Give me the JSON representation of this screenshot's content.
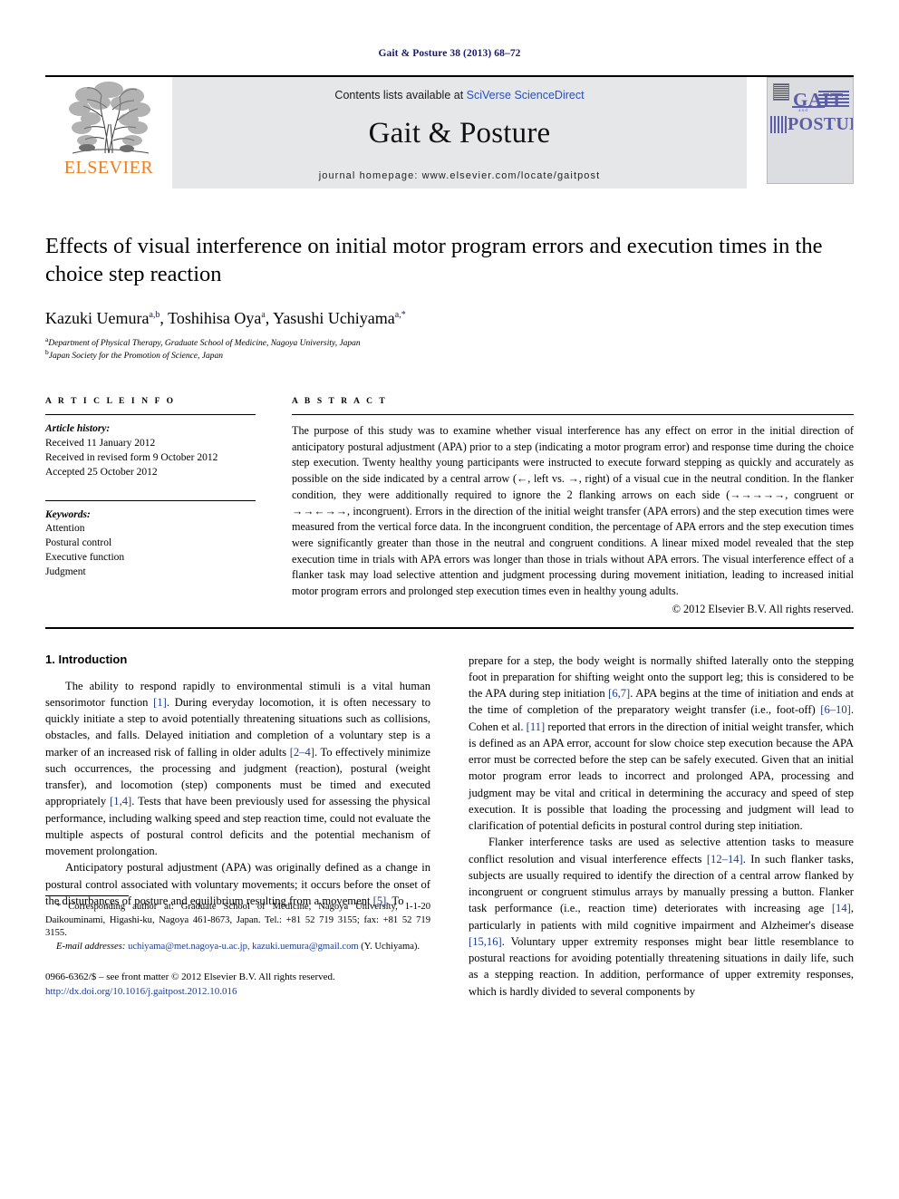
{
  "running_head": "Gait & Posture 38 (2013) 68–72",
  "masthead": {
    "contents_prefix": "Contents lists available at ",
    "sciencedirect": "SciVerse ScienceDirect",
    "journal_title": "Gait & Posture",
    "homepage": "journal homepage: www.elsevier.com/locate/gaitpost",
    "publisher_name": "ELSEVIER",
    "cover": {
      "line1": "GAIT",
      "line_mid": "and",
      "line2": "POSTURE"
    },
    "accent_link_color": "#2a4fb8",
    "elsevier_orange": "#ef7d22",
    "cover_purple": "#5b5ea6"
  },
  "article": {
    "title": "Effects of visual interference on initial motor program errors and execution times in the choice step reaction",
    "authors": "Kazuki Uemura a,b, Toshihisa Oya a, Yasushi Uchiyama a,*",
    "author_list": [
      {
        "name": "Kazuki Uemura",
        "sup": "a,b"
      },
      {
        "name": "Toshihisa Oya",
        "sup": "a"
      },
      {
        "name": "Yasushi Uchiyama",
        "sup": "a,*"
      }
    ],
    "affiliations": [
      {
        "marker": "a",
        "text": "Department of Physical Therapy, Graduate School of Medicine, Nagoya University, Japan"
      },
      {
        "marker": "b",
        "text": "Japan Society for the Promotion of Science, Japan"
      }
    ]
  },
  "article_info": {
    "label": "A R T I C L E    I N F O",
    "history_head": "Article history:",
    "history": [
      "Received 11 January 2012",
      "Received in revised form 9 October 2012",
      "Accepted 25 October 2012"
    ],
    "keywords_head": "Keywords:",
    "keywords": [
      "Attention",
      "Postural control",
      "Executive function",
      "Judgment"
    ]
  },
  "abstract": {
    "label": "A B S T R A C T",
    "text": "The purpose of this study was to examine whether visual interference has any effect on error in the initial direction of anticipatory postural adjustment (APA) prior to a step (indicating a motor program error) and response time during the choice step execution. Twenty healthy young participants were instructed to execute forward stepping as quickly and accurately as possible on the side indicated by a central arrow (←, left vs. →, right) of a visual cue in the neutral condition. In the flanker condition, they were additionally required to ignore the 2 flanking arrows on each side (→→→→→, congruent or →→←→→, incongruent). Errors in the direction of the initial weight transfer (APA errors) and the step execution times were measured from the vertical force data. In the incongruent condition, the percentage of APA errors and the step execution times were significantly greater than those in the neutral and congruent conditions. A linear mixed model revealed that the step execution time in trials with APA errors was longer than those in trials without APA errors. The visual interference effect of a flanker task may load selective attention and judgment processing during movement initiation, leading to increased initial motor program errors and prolonged step execution times even in healthy young adults.",
    "copyright": "© 2012 Elsevier B.V. All rights reserved."
  },
  "introduction": {
    "heading": "1. Introduction",
    "left_paragraphs": [
      "The ability to respond rapidly to environmental stimuli is a vital human sensorimotor function [1]. During everyday locomotion, it is often necessary to quickly initiate a step to avoid potentially threatening situations such as collisions, obstacles, and falls. Delayed initiation and completion of a voluntary step is a marker of an increased risk of falling in older adults [2–4]. To effectively minimize such occurrences, the processing and judgment (reaction), postural (weight transfer), and locomotion (step) components must be timed and executed appropriately [1,4]. Tests that have been previously used for assessing the physical performance, including walking speed and step reaction time, could not evaluate the multiple aspects of postural control deficits and the potential mechanism of movement prolongation.",
      "Anticipatory postural adjustment (APA) was originally defined as a change in postural control associated with voluntary movements; it occurs before the onset of the disturbances of posture and equilibrium resulting from a movement [5]. To"
    ],
    "right_paragraphs": [
      "prepare for a step, the body weight is normally shifted laterally onto the stepping foot in preparation for shifting weight onto the support leg; this is considered to be the APA during step initiation [6,7]. APA begins at the time of initiation and ends at the time of completion of the preparatory weight transfer (i.e., foot-off) [6–10]. Cohen et al. [11] reported that errors in the direction of initial weight transfer, which is defined as an APA error, account for slow choice step execution because the APA error must be corrected before the step can be safely executed. Given that an initial motor program error leads to incorrect and prolonged APA, processing and judgment may be vital and critical in determining the accuracy and speed of step execution. It is possible that loading the processing and judgment will lead to clarification of potential deficits in postural control during step initiation.",
      "Flanker interference tasks are used as selective attention tasks to measure conflict resolution and visual interference effects [12–14]. In such flanker tasks, subjects are usually required to identify the direction of a central arrow flanked by incongruent or congruent stimulus arrays by manually pressing a button. Flanker task performance (i.e., reaction time) deteriorates with increasing age [14], particularly in patients with mild cognitive impairment and Alzheimer's disease [15,16]. Voluntary upper extremity responses might bear little resemblance to postural reactions for avoiding potentially threatening situations in daily life, such as a stepping reaction. In addition, performance of upper extremity responses, which is hardly divided to several components by"
    ]
  },
  "footnotes": {
    "corresponding": "* Corresponding author at: Graduate School of Medicine, Nagoya University, 1-1-20 Daikouminami, Higashi-ku, Nagoya 461-8673, Japan. Tel.: +81 52 719 3155; fax: +81 52 719 3155.",
    "email_label": "E-mail addresses:",
    "emails": "uchiyama@met.nagoya-u.ac.jp, kazuki.uemura@gmail.com",
    "email_tail": "(Y. Uchiyama).",
    "issn_line": "0966-6362/$ – see front matter © 2012 Elsevier B.V. All rights reserved.",
    "doi": "http://dx.doi.org/10.1016/j.gaitpost.2012.10.016"
  }
}
